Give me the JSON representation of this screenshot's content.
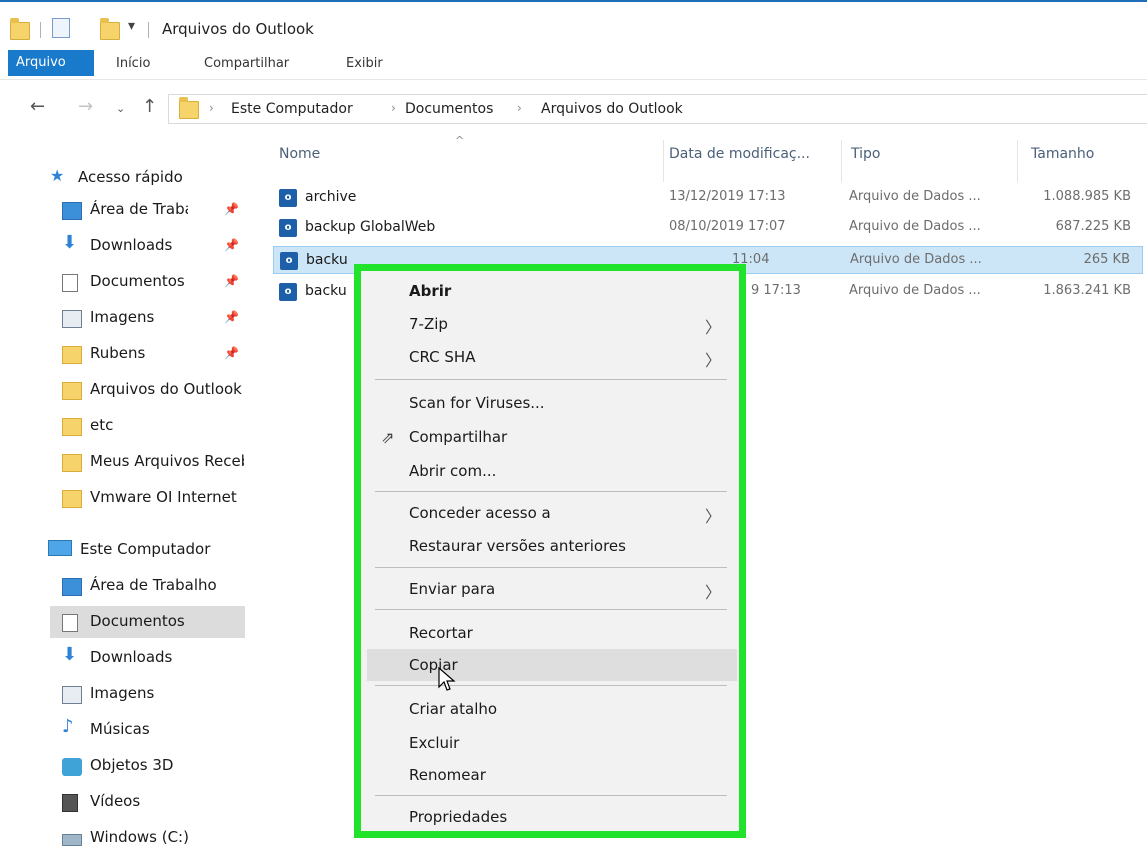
{
  "window": {
    "title": "Arquivos do Outlook"
  },
  "ribbon": {
    "tabs": [
      "Arquivo",
      "Início",
      "Compartilhar",
      "Exibir"
    ]
  },
  "address": {
    "crumbs": [
      "Este Computador",
      "Documentos",
      "Arquivos do Outlook"
    ]
  },
  "nav": {
    "quick_access": "Acesso rápido",
    "quick_items": [
      {
        "label": "Área de Trabalho",
        "icon": "desktop-icon",
        "pinned": true
      },
      {
        "label": "Downloads",
        "icon": "download-icon",
        "pinned": true
      },
      {
        "label": "Documentos",
        "icon": "documents-icon",
        "pinned": true
      },
      {
        "label": "Imagens",
        "icon": "pictures-icon",
        "pinned": true
      },
      {
        "label": "Rubens",
        "icon": "folder-icon",
        "pinned": true
      },
      {
        "label": "Arquivos do Outlook",
        "icon": "folder-icon",
        "pinned": false
      },
      {
        "label": "etc",
        "icon": "folder-icon",
        "pinned": false
      },
      {
        "label": "Meus Arquivos Recebidos",
        "icon": "folder-icon",
        "pinned": false
      },
      {
        "label": "Vmware OI Internet",
        "icon": "folder-icon",
        "pinned": false
      }
    ],
    "this_pc": "Este Computador",
    "pc_items": [
      {
        "label": "Área de Trabalho",
        "icon": "desktop-icon"
      },
      {
        "label": "Documentos",
        "icon": "documents-icon",
        "selected": true
      },
      {
        "label": "Downloads",
        "icon": "download-icon"
      },
      {
        "label": "Imagens",
        "icon": "pictures-icon"
      },
      {
        "label": "Músicas",
        "icon": "music-icon"
      },
      {
        "label": "Objetos 3D",
        "icon": "3d-objects-icon"
      },
      {
        "label": "Vídeos",
        "icon": "videos-icon"
      },
      {
        "label": "Windows (C:)",
        "icon": "drive-icon"
      }
    ]
  },
  "files": {
    "columns": [
      "Nome",
      "Data de modificaç...",
      "Tipo",
      "Tamanho"
    ],
    "rows": [
      {
        "name": "archive",
        "date": "13/12/2019 17:13",
        "type": "Arquivo de Dados ...",
        "size": "1.088.985 KB"
      },
      {
        "name": "backup GlobalWeb",
        "date": "08/10/2019 17:07",
        "type": "Arquivo de Dados ...",
        "size": "687.225 KB"
      },
      {
        "name": "backu",
        "date": "11:04",
        "type": "Arquivo de Dados ...",
        "size": "265 KB",
        "selected": true
      },
      {
        "name": "backu",
        "date": "9 17:13",
        "type": "Arquivo de Dados ...",
        "size": "1.863.241 KB"
      }
    ]
  },
  "context_menu": {
    "items": [
      {
        "label": "Abrir",
        "bold": true
      },
      {
        "label": "7-Zip",
        "submenu": true
      },
      {
        "label": "CRC SHA",
        "submenu": true
      },
      {
        "label": "Scan for Viruses..."
      },
      {
        "label": "Compartilhar",
        "icon": "share-icon"
      },
      {
        "label": "Abrir com..."
      },
      {
        "label": "Conceder acesso a",
        "submenu": true
      },
      {
        "label": "Restaurar versões anteriores"
      },
      {
        "label": "Enviar para",
        "submenu": true
      },
      {
        "label": "Recortar"
      },
      {
        "label": "Copiar",
        "hovered": true
      },
      {
        "label": "Criar atalho"
      },
      {
        "label": "Excluir"
      },
      {
        "label": "Renomear"
      },
      {
        "label": "Propriedades"
      }
    ],
    "arrow_glyph": "〉"
  }
}
